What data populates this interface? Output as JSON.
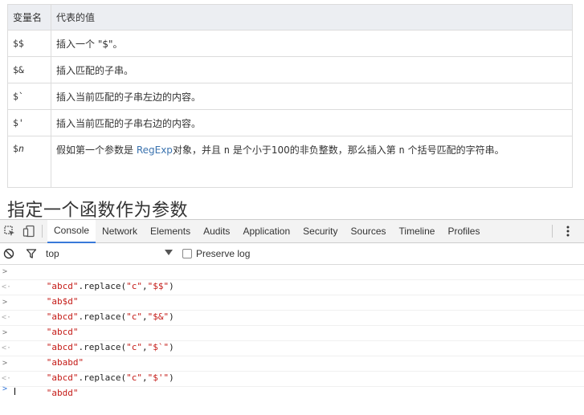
{
  "table": {
    "headers": [
      "变量名",
      "代表的值"
    ],
    "rows": [
      {
        "name": "$$",
        "desc": "插入一个 \"$\"。"
      },
      {
        "name": "$&",
        "desc": "插入匹配的子串。"
      },
      {
        "name": "$`",
        "desc": "插入当前匹配的子串左边的内容。"
      },
      {
        "name": "$'",
        "desc": "插入当前匹配的子串右边的内容。"
      }
    ],
    "last_row": {
      "name_prefix": "$",
      "name_italic": "n",
      "desc_before": "假如第一个参数是 ",
      "desc_link": "RegExp",
      "desc_middle": "对象，并且 ",
      "desc_n1": "n",
      "desc_middle2": " 是个小于100的非负整数，那么插入第 ",
      "desc_n2": "n",
      "desc_after": " 个括号匹配的字符串。"
    }
  },
  "heading": "指定一个函数作为参数",
  "devtools": {
    "tabs": [
      "Console",
      "Network",
      "Elements",
      "Audits",
      "Application",
      "Security",
      "Sources",
      "Timeline",
      "Profiles"
    ],
    "toolbar": {
      "context": "top",
      "preserve_log": "Preserve log"
    },
    "console": [
      {
        "q": "\"abcd\"",
        "dot": ".replace(",
        "a1": "\"c\"",
        "comma": ",",
        "a2": "\"$$\"",
        "close": ")",
        "r": "\"ab$d\""
      },
      {
        "q": "\"abcd\"",
        "dot": ".replace(",
        "a1": "\"c\"",
        "comma": ",",
        "a2": "\"$&\"",
        "close": ")",
        "r": "\"abcd\""
      },
      {
        "q": "\"abcd\"",
        "dot": ".replace(",
        "a1": "\"c\"",
        "comma": ",",
        "a2": "\"$`\"",
        "close": ")",
        "r": "\"ababd\""
      },
      {
        "q": "\"abcd\"",
        "dot": ".replace(",
        "a1": "\"c\"",
        "comma": ",",
        "a2": "\"$'\"",
        "close": ")",
        "r": "\"abdd\""
      }
    ]
  }
}
